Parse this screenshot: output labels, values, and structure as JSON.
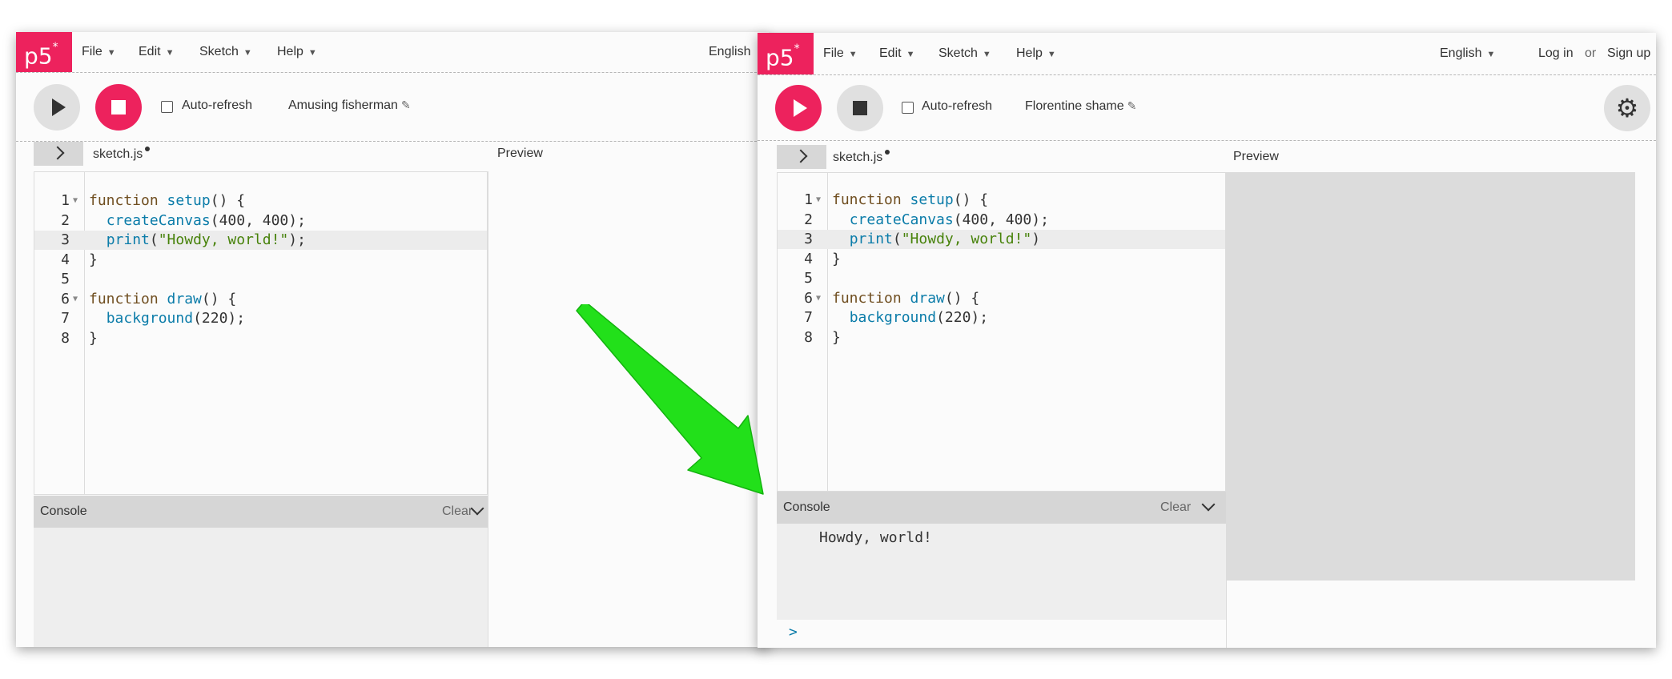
{
  "left_window": {
    "logo": "p5",
    "logo_sup": "*",
    "menu": {
      "file": "File",
      "edit": "Edit",
      "sketch": "Sketch",
      "help": "Help",
      "language": "English"
    },
    "toolbar": {
      "auto_refresh": "Auto-refresh",
      "project_name": "Amusing fisherman"
    },
    "editor": {
      "tab": "sketch.js",
      "preview": "Preview",
      "lines": [
        {
          "n": "1",
          "text": "function setup() {"
        },
        {
          "n": "2",
          "text": "  createCanvas(400, 400);"
        },
        {
          "n": "3",
          "text": "  print(\"Howdy, world!\");"
        },
        {
          "n": "4",
          "text": "}"
        },
        {
          "n": "5",
          "text": ""
        },
        {
          "n": "6",
          "text": "function draw() {"
        },
        {
          "n": "7",
          "text": "  background(220);"
        },
        {
          "n": "8",
          "text": "}"
        }
      ]
    },
    "console": {
      "title": "Console",
      "clear": "Clear"
    }
  },
  "right_window": {
    "logo": "p5",
    "logo_sup": "*",
    "menu": {
      "file": "File",
      "edit": "Edit",
      "sketch": "Sketch",
      "help": "Help",
      "language": "English",
      "login": "Log in",
      "or": "or",
      "signup": "Sign up"
    },
    "toolbar": {
      "auto_refresh": "Auto-refresh",
      "project_name": "Florentine shame"
    },
    "editor": {
      "tab": "sketch.js",
      "preview": "Preview",
      "lines": [
        {
          "n": "1",
          "text": "function setup() {"
        },
        {
          "n": "2",
          "text": "  createCanvas(400, 400);"
        },
        {
          "n": "3",
          "text": "  print(\"Howdy, world!\")"
        },
        {
          "n": "4",
          "text": "}"
        },
        {
          "n": "5",
          "text": ""
        },
        {
          "n": "6",
          "text": "function draw() {"
        },
        {
          "n": "7",
          "text": "  background(220);"
        },
        {
          "n": "8",
          "text": "}"
        }
      ]
    },
    "console": {
      "title": "Console",
      "clear": "Clear",
      "output": "Howdy, world!",
      "prompt": ">"
    }
  },
  "colors": {
    "brand": "#ed225d",
    "arrow": "#22e01a",
    "keyword": "#704f21",
    "function": "#0b7ca9",
    "string": "#47820a"
  },
  "icons": [
    "play-icon",
    "stop-icon",
    "pencil-icon",
    "chevron-right-icon",
    "chevron-down-icon",
    "gear-icon",
    "caret-down-icon"
  ]
}
